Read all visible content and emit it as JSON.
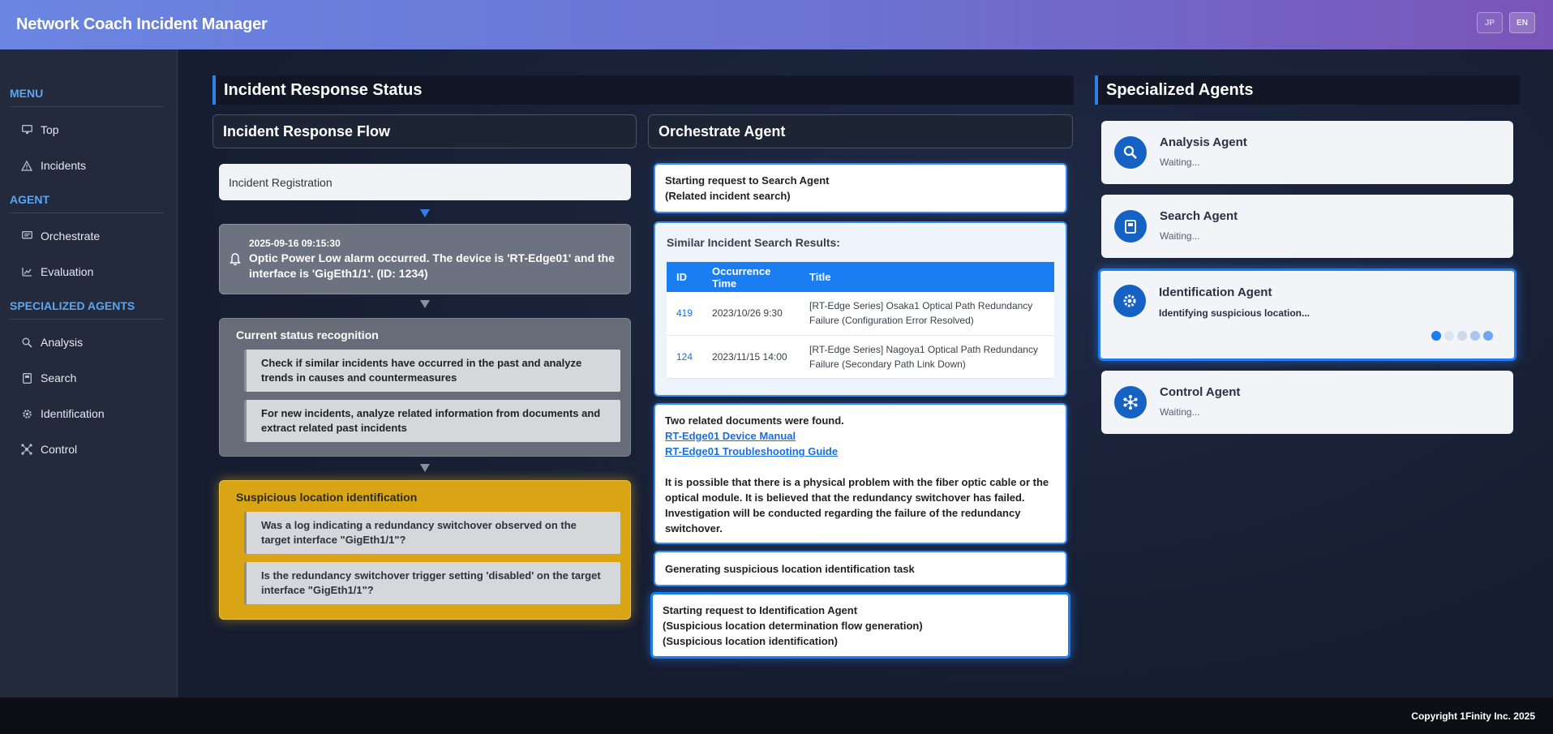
{
  "header": {
    "title": "Network Coach Incident Manager",
    "lang_jp": "JP",
    "lang_en": "EN"
  },
  "sidebar": {
    "menu_label": "MENU",
    "menu_items": [
      {
        "label": "Top",
        "icon": "monitor-icon"
      },
      {
        "label": "Incidents",
        "icon": "warning-icon"
      }
    ],
    "agent_label": "AGENT",
    "agent_items": [
      {
        "label": "Orchestrate",
        "icon": "orchestrate-icon"
      },
      {
        "label": "Evaluation",
        "icon": "chart-icon"
      }
    ],
    "specialized_label": "SPECIALIZED AGENTS",
    "specialized_items": [
      {
        "label": "Analysis",
        "icon": "search-icon"
      },
      {
        "label": "Search",
        "icon": "book-icon"
      },
      {
        "label": "Identification",
        "icon": "gear-icon"
      },
      {
        "label": "Control",
        "icon": "network-icon"
      }
    ]
  },
  "status": {
    "title": "Incident Response Status",
    "flow_title": "Incident Response Flow",
    "registration": "Incident Registration",
    "alarm_time": "2025-09-16 09:15:30",
    "alarm_text": "Optic Power Low alarm occurred. The device is 'RT-Edge01' and the interface is 'GigEth1/1'. (ID: 1234)",
    "recognition_title": "Current status recognition",
    "recognition_items": [
      "Check if similar incidents have occurred in the past and analyze trends in causes and countermeasures",
      "For new incidents, analyze related information from documents and extract related past incidents"
    ],
    "suspicious_title": "Suspicious location identification",
    "suspicious_items": [
      "Was a log indicating a redundancy switchover observed on the target interface \"GigEth1/1\"?",
      "Is the redundancy switchover trigger setting 'disabled' on the target interface \"GigEth1/1\"?"
    ]
  },
  "orchestrate": {
    "title": "Orchestrate Agent",
    "msg1_line1": "Starting request to Search Agent",
    "msg1_line2": "(Related incident search)",
    "search_title": "Similar Incident Search Results:",
    "table_headers": [
      "ID",
      "Occurrence Time",
      "Title"
    ],
    "table_rows": [
      {
        "id": "419",
        "time": "2023/10/26 9:30",
        "title": "[RT-Edge Series] Osaka1 Optical Path Redundancy Failure (Configuration Error Resolved)"
      },
      {
        "id": "124",
        "time": "2023/11/15 14:00",
        "title": "[RT-Edge Series] Nagoya1 Optical Path Redundancy Failure (Secondary Path Link Down)"
      }
    ],
    "docs_found": "Two related documents were found.",
    "doc_link1": "RT-Edge01 Device Manual",
    "doc_link2": "RT-Edge01 Troubleshooting Guide",
    "analysis_text": "It is possible that there is a physical problem with the fiber optic cable or the optical module. It is believed that the redundancy switchover has failed. Investigation will be conducted regarding the failure of the redundancy switchover.",
    "msg_generating": "Generating suspicious location identification task",
    "msg_last_line1": "Starting request to Identification Agent",
    "msg_last_line2": "(Suspicious location determination flow generation)",
    "msg_last_line3": "(Suspicious location identification)"
  },
  "agents": {
    "title": "Specialized Agents",
    "list": [
      {
        "name": "Analysis Agent",
        "status": "Waiting...",
        "icon": "search-icon"
      },
      {
        "name": "Search Agent",
        "status": "Waiting...",
        "icon": "book-icon"
      },
      {
        "name": "Identification Agent",
        "status": "Identifying suspicious location...",
        "icon": "gear-icon"
      },
      {
        "name": "Control Agent",
        "status": "Waiting...",
        "icon": "network-icon"
      }
    ]
  },
  "footer": {
    "copyright": "Copyright 1Finity Inc. 2025"
  },
  "colors": {
    "accent": "#1a7ef2",
    "highlight": "#d9a515",
    "header_start": "#6a86e0",
    "header_end": "#7a55b8"
  }
}
